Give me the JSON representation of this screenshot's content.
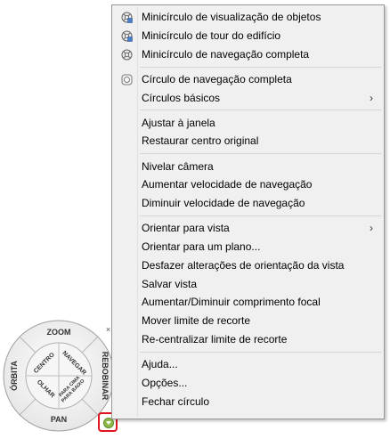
{
  "menu": {
    "groups": [
      {
        "items": [
          {
            "label": "Minicírculo de visualização de objetos",
            "icon": "mini-view-object-wheel-icon"
          },
          {
            "label": "Minicírculo de tour do edifício",
            "icon": "mini-tour-building-wheel-icon"
          },
          {
            "label": "Minicírculo de navegação completa",
            "icon": "mini-full-navigation-wheel-icon"
          }
        ]
      },
      {
        "items": [
          {
            "label": "Círculo de navegação completa",
            "icon": "full-navigation-wheel-icon"
          },
          {
            "label": "Círculos básicos",
            "submenu": true,
            "arrow": "›"
          }
        ]
      },
      {
        "items": [
          {
            "label": "Ajustar à janela"
          },
          {
            "label": "Restaurar centro original"
          }
        ]
      },
      {
        "items": [
          {
            "label": "Nivelar câmera"
          },
          {
            "label": "Aumentar velocidade de navegação"
          },
          {
            "label": "Diminuir velocidade de navegação"
          }
        ]
      },
      {
        "items": [
          {
            "label": "Orientar para vista",
            "submenu": true,
            "arrow": "›"
          },
          {
            "label": "Orientar para um plano..."
          },
          {
            "label": "Desfazer alterações de orientação da vista"
          },
          {
            "label": "Salvar vista"
          },
          {
            "label": "Aumentar/Diminuir comprimento focal"
          },
          {
            "label": "Mover limite de recorte"
          },
          {
            "label": "Re-centralizar limite de recorte"
          }
        ]
      },
      {
        "items": [
          {
            "label": "Ajuda..."
          },
          {
            "label": "Opções..."
          },
          {
            "label": "Fechar círculo"
          }
        ]
      }
    ]
  },
  "wheel": {
    "zoom": "ZOOM",
    "orbit": "ÓRBITA",
    "rewind": "REBOBINAR",
    "pan": "PAN",
    "center": "CENTRO",
    "walk": "NAVEGAR",
    "look": "OLHAR",
    "updown_line1": "PARA CIMA",
    "updown_line2": "PARA BAIXO",
    "close_glyph": "×"
  },
  "colors": {
    "menu_background": "#f0f0f0",
    "menu_border": "#979797",
    "highlight_box": "#e0141e",
    "wheel_face": "#f2f2f2"
  }
}
